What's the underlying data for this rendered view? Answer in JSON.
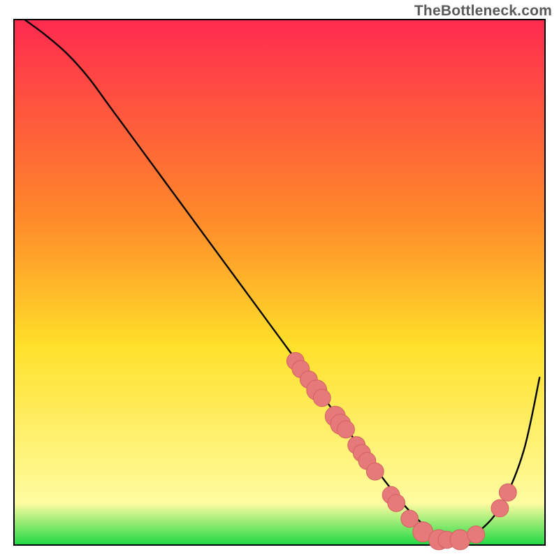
{
  "attribution": "TheBottleneck.com",
  "colors": {
    "gradient_top": "#ff2a4f",
    "gradient_mid1": "#ff8a2a",
    "gradient_mid2": "#ffe02a",
    "gradient_mid3": "#fffca0",
    "gradient_bottom": "#1fd943",
    "curve": "#000000",
    "marker_fill": "#e67a7a",
    "marker_stroke": "#d45f5f",
    "frame": "#000000"
  },
  "chart_data": {
    "type": "line",
    "title": "",
    "xlabel": "",
    "ylabel": "",
    "xlim": [
      0,
      100
    ],
    "ylim": [
      0,
      100
    ],
    "grid": false,
    "legend": false,
    "series": [
      {
        "name": "curve",
        "x": [
          2,
          6,
          10,
          14,
          18,
          22,
          26,
          30,
          34,
          38,
          42,
          46,
          50,
          54,
          58,
          62,
          66,
          70,
          74,
          78,
          80,
          84,
          88,
          92,
          96,
          99
        ],
        "values": [
          100,
          97,
          93.5,
          89,
          83.5,
          78,
          72.5,
          67,
          61.5,
          56,
          50.5,
          45,
          39.5,
          34,
          28.5,
          23,
          17.5,
          12,
          7,
          3,
          1.5,
          1,
          3,
          8,
          18,
          32
        ]
      }
    ],
    "markers": [
      {
        "x": 53,
        "y": 35,
        "r": 1.3
      },
      {
        "x": 54,
        "y": 33.5,
        "r": 1.3
      },
      {
        "x": 55.5,
        "y": 31.5,
        "r": 1.3
      },
      {
        "x": 57,
        "y": 29.5,
        "r": 1.6
      },
      {
        "x": 58,
        "y": 28,
        "r": 1.3
      },
      {
        "x": 60.5,
        "y": 24.5,
        "r": 1.6
      },
      {
        "x": 61.5,
        "y": 23,
        "r": 1.6
      },
      {
        "x": 62.5,
        "y": 22,
        "r": 1.3
      },
      {
        "x": 64.5,
        "y": 19,
        "r": 1.3
      },
      {
        "x": 65.5,
        "y": 17.5,
        "r": 1.3
      },
      {
        "x": 66.5,
        "y": 16,
        "r": 1.3
      },
      {
        "x": 68,
        "y": 14,
        "r": 1.3
      },
      {
        "x": 71,
        "y": 9.5,
        "r": 1.3
      },
      {
        "x": 72,
        "y": 8,
        "r": 1.3
      },
      {
        "x": 74.5,
        "y": 5,
        "r": 1.3
      },
      {
        "x": 77,
        "y": 2.5,
        "r": 1.6
      },
      {
        "x": 80,
        "y": 1,
        "r": 1.6
      },
      {
        "x": 81.5,
        "y": 1,
        "r": 1.3
      },
      {
        "x": 84,
        "y": 1,
        "r": 1.6
      },
      {
        "x": 87,
        "y": 2,
        "r": 1.3
      },
      {
        "x": 91.5,
        "y": 7,
        "r": 1.3
      },
      {
        "x": 93,
        "y": 10,
        "r": 1.3
      }
    ]
  }
}
